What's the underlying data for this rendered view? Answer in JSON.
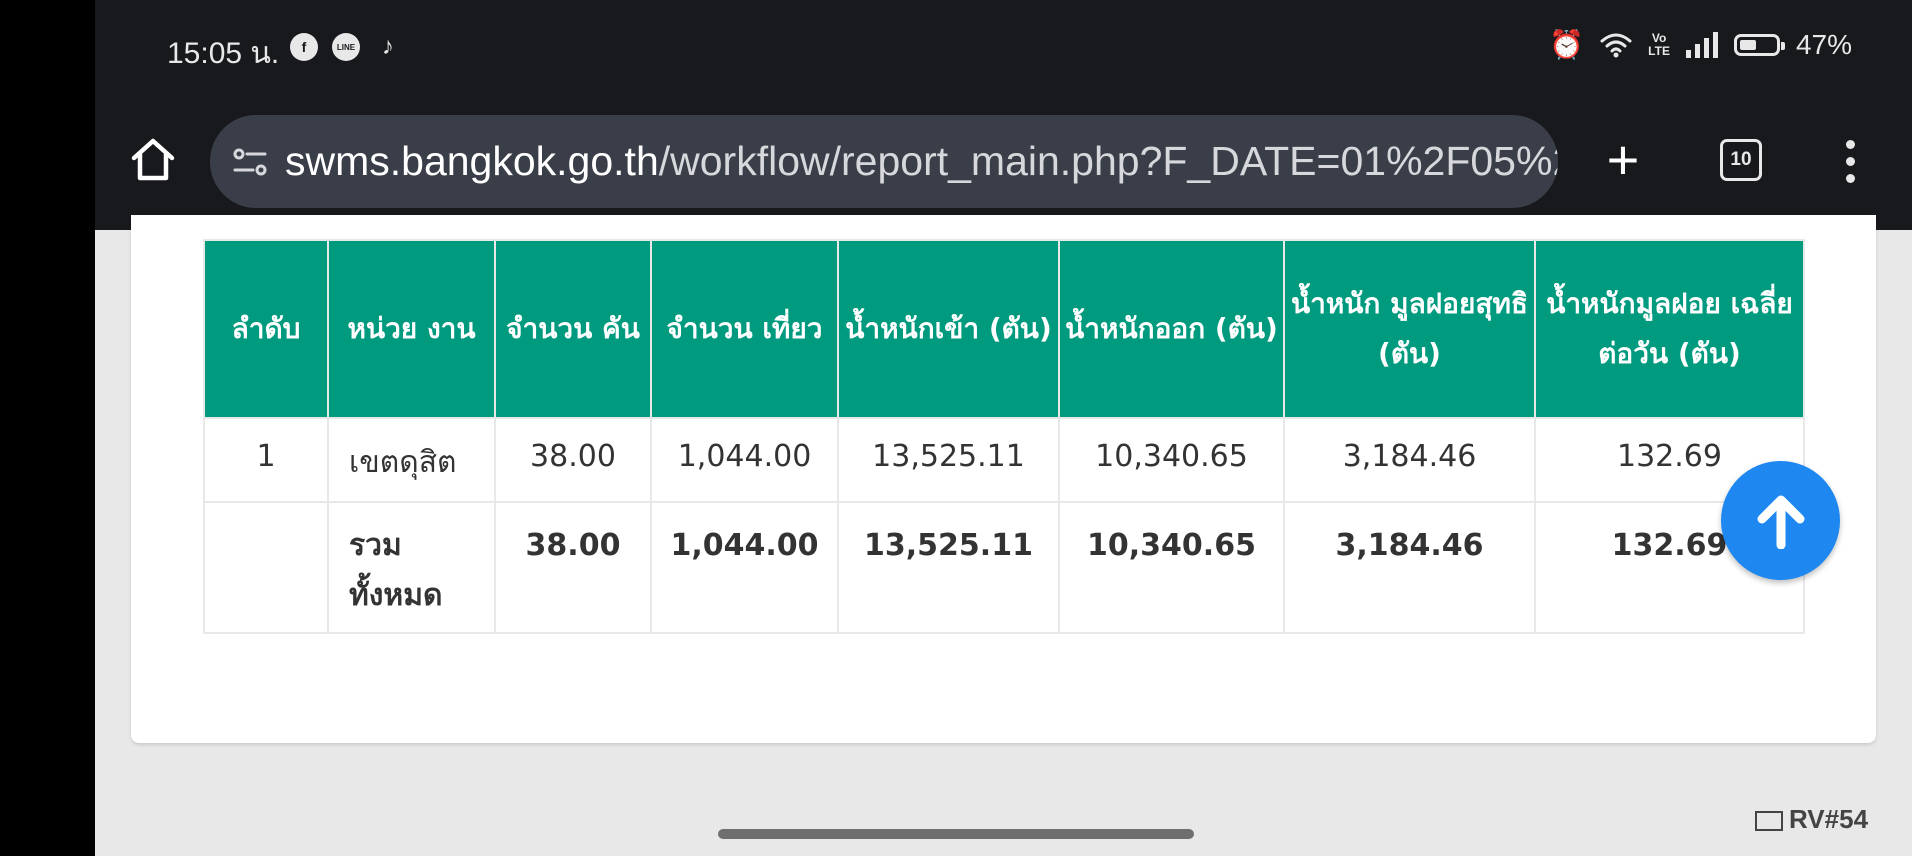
{
  "status_bar": {
    "time": "15:05 น.",
    "app_icons": [
      {
        "name": "facebook-icon",
        "glyph": "f"
      },
      {
        "name": "line-icon",
        "glyph": "LINE"
      },
      {
        "name": "tiktok-icon",
        "glyph": "♪"
      }
    ],
    "volte_top": "Vo",
    "volte_bottom": "LTE",
    "battery_percent": "47%",
    "battery_level": 0.47
  },
  "browser": {
    "url_host": "swms.bangkok.go.th",
    "url_path": "/workflow/report_main.php?F_DATE=01%2F05%2",
    "plus_label": "+",
    "tab_count": "10"
  },
  "table": {
    "headers": [
      "ลำดับ",
      "หน่วย งาน",
      "จำนวน คัน",
      "จำนวน เที่ยว",
      "น้ำหนักเข้า (ตัน)",
      "น้ำหนักออก (ตัน)",
      "น้ำหนัก มูลฝอยสุทธิ (ตัน)",
      "น้ำหนักมูลฝอย เฉลี่ยต่อวัน (ตัน)"
    ],
    "rows": [
      {
        "no": "1",
        "unit": "เขตดุสิต",
        "vehicles": "38.00",
        "trips": "1,044.00",
        "weight_in": "13,525.11",
        "weight_out": "10,340.65",
        "net_weight": "3,184.46",
        "daily_avg": "132.69"
      }
    ],
    "total": {
      "label": "รวม ทั้งหมด",
      "vehicles": "38.00",
      "trips": "1,044.00",
      "weight_in": "13,525.11",
      "weight_out": "10,340.65",
      "net_weight": "3,184.46",
      "daily_avg": "132.69"
    }
  },
  "footer": {
    "version_text": "RV#54"
  },
  "colors": {
    "header_bg": "#009a7f",
    "fab": "#1e88f0",
    "browser_bg": "#17191d",
    "url_bar": "#3a3e48"
  }
}
